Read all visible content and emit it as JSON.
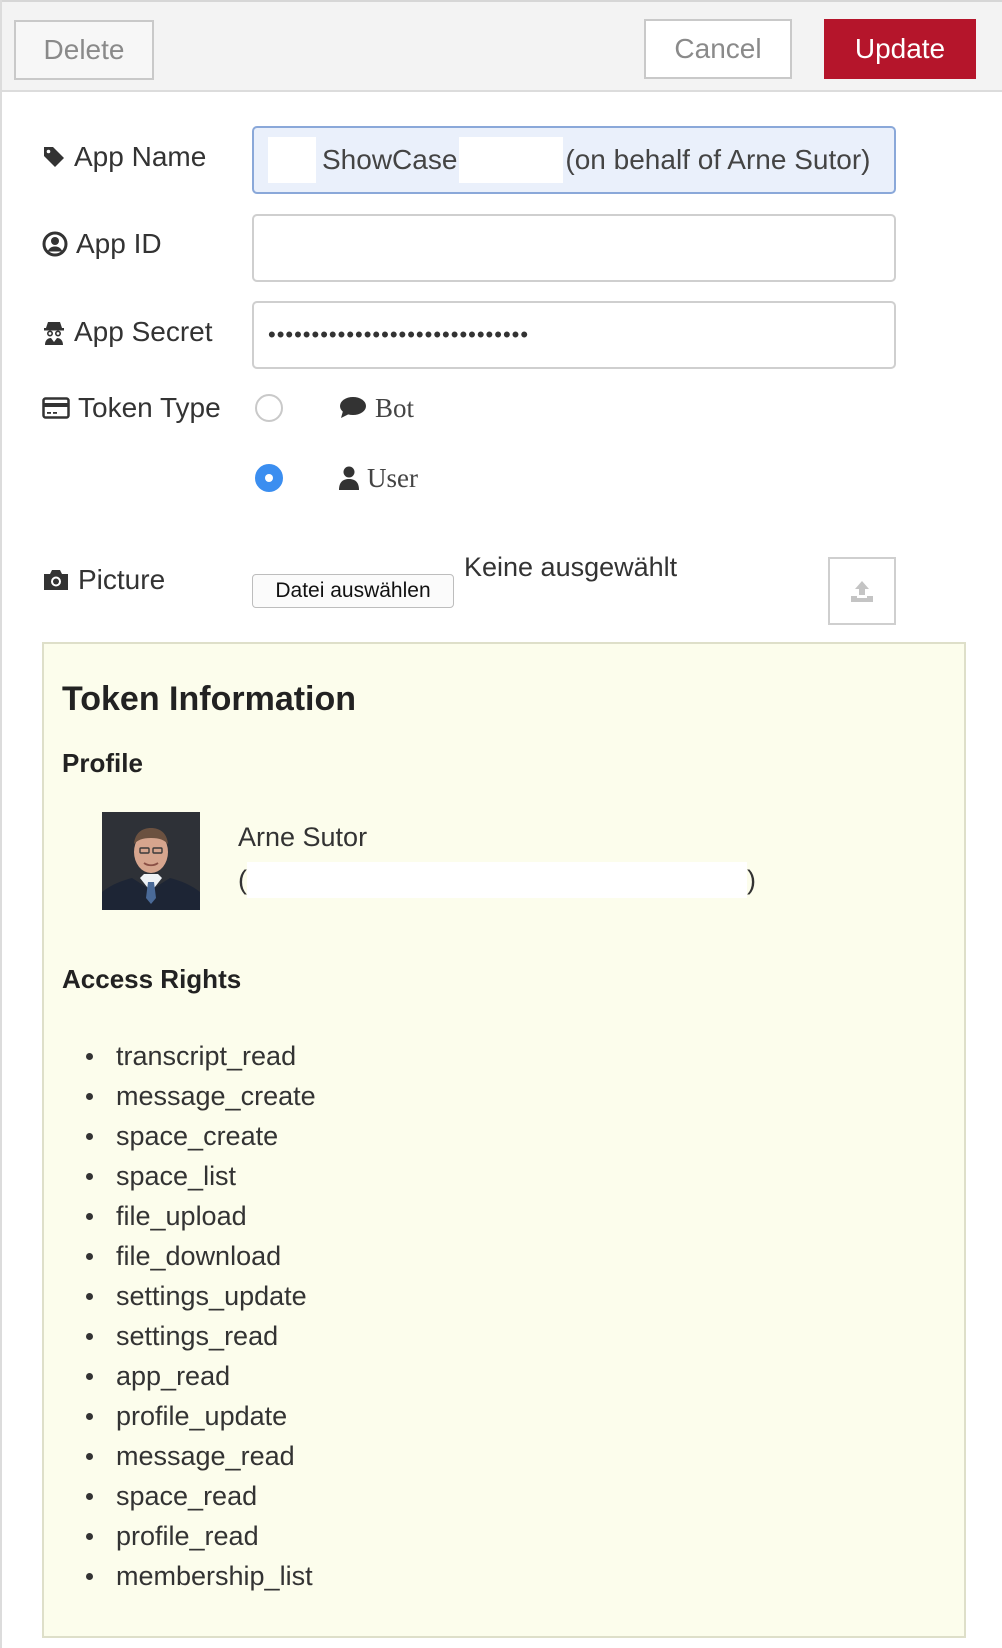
{
  "toolbar": {
    "delete_label": "Delete",
    "cancel_label": "Cancel",
    "update_label": "Update"
  },
  "form": {
    "app_name": {
      "label": "App Name",
      "value_prefix": "ShowCase",
      "value_suffix": "(on behalf of Arne Sutor)"
    },
    "app_id": {
      "label": "App ID",
      "value": ""
    },
    "app_secret": {
      "label": "App Secret",
      "value": "••••••••••••••••••••••••••••••"
    },
    "token_type": {
      "label": "Token Type",
      "options": [
        {
          "label": "Bot",
          "selected": false
        },
        {
          "label": "User",
          "selected": true
        }
      ]
    },
    "picture": {
      "label": "Picture",
      "choose_file_label": "Datei auswählen",
      "file_status": "Keine ausgewählt"
    }
  },
  "token_info": {
    "title": "Token Information",
    "profile_heading": "Profile",
    "profile_name": "Arne Sutor",
    "profile_id_open": "(",
    "profile_id_close": ")",
    "access_rights_heading": "Access Rights",
    "access_rights": [
      "transcript_read",
      "message_create",
      "space_create",
      "space_list",
      "file_upload",
      "file_download",
      "settings_update",
      "settings_read",
      "app_read",
      "profile_update",
      "message_read",
      "space_read",
      "profile_read",
      "membership_list"
    ]
  },
  "colors": {
    "update_button": "#b5152b",
    "radio_selected": "#3b8ef0",
    "panel_background": "#fcfdec"
  },
  "icons": [
    "tag-icon",
    "user-circle-icon",
    "user-secret-icon",
    "credit-card-icon",
    "comment-icon",
    "user-icon",
    "camera-icon",
    "upload-icon"
  ]
}
